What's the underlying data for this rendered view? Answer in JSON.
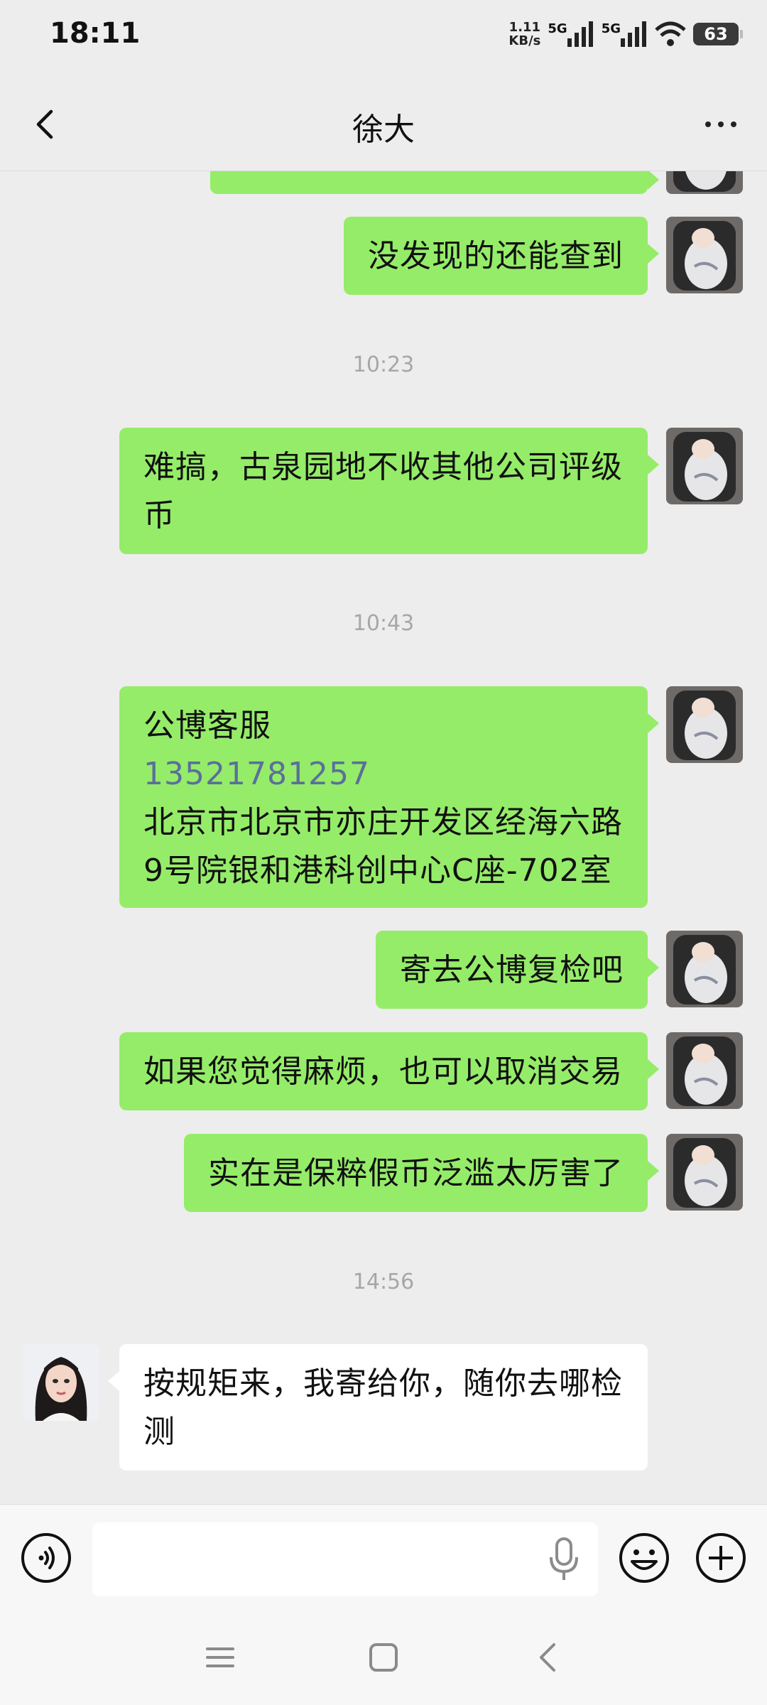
{
  "status_bar": {
    "time": "18:11",
    "net_speed_value": "1.11",
    "net_speed_unit": "KB/s",
    "signal1_label": "5G",
    "signal2_label": "5G",
    "battery": "63"
  },
  "header": {
    "title": "徐大"
  },
  "messages": [
    {
      "id": "m0",
      "sender": "me",
      "text": ""
    },
    {
      "id": "m1",
      "sender": "me",
      "text": "没发现的还能查到"
    },
    {
      "id": "t1",
      "type": "time",
      "text": "10:23"
    },
    {
      "id": "m2",
      "sender": "me",
      "line1": "难搞，古泉园地不收其他公司评级",
      "line2": "币"
    },
    {
      "id": "t2",
      "type": "time",
      "text": "10:43"
    },
    {
      "id": "m3",
      "sender": "me",
      "line1": "公博客服",
      "phone": "13521781257",
      "line3": "北京市北京市亦庄开发区经海六路",
      "line4": "9号院银和港科创中心C座-702室"
    },
    {
      "id": "m4",
      "sender": "me",
      "text": "寄去公博复检吧"
    },
    {
      "id": "m5",
      "sender": "me",
      "text": "如果您觉得麻烦，也可以取消交易"
    },
    {
      "id": "m6",
      "sender": "me",
      "text": "实在是保粹假币泛滥太厉害了"
    },
    {
      "id": "t3",
      "type": "time",
      "text": "14:56"
    },
    {
      "id": "m7",
      "sender": "peer",
      "line1": "按规矩来，我寄给你，随你去哪检",
      "line2": "测"
    }
  ],
  "input": {
    "value": "",
    "placeholder": ""
  },
  "icons": {
    "back": "back-arrow-icon",
    "more": "more-dots-icon",
    "voice": "voice-icon",
    "mic": "microphone-icon",
    "emoji": "emoji-icon",
    "plus": "plus-icon"
  },
  "colors": {
    "my_bubble": "#95ec69",
    "peer_bubble": "#ffffff",
    "background": "#ededed",
    "phone_link": "#5a6f9a",
    "timestamp": "#a7a7a7"
  }
}
